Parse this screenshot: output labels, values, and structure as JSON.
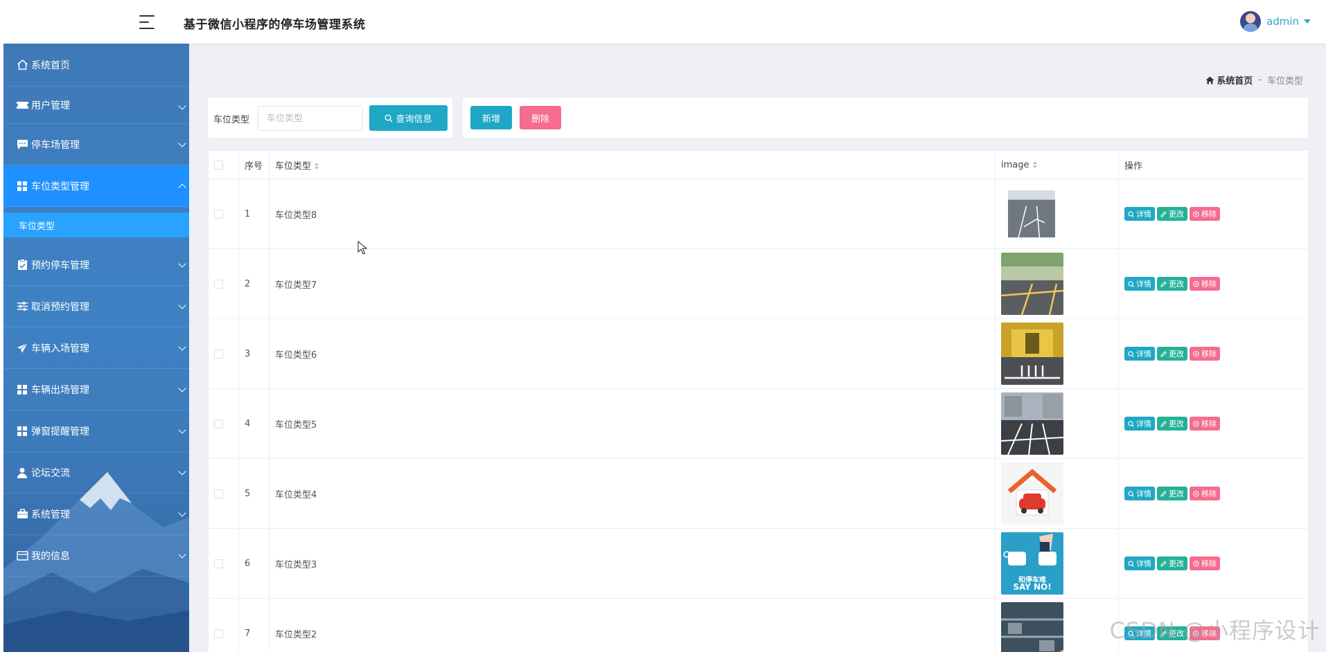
{
  "app": {
    "title": "基于微信小程序的停车场管理系统",
    "user": "admin"
  },
  "sidebar": {
    "items": [
      {
        "label": "系统首页",
        "icon": "home-icon"
      },
      {
        "label": "用户管理",
        "icon": "ticket-icon"
      },
      {
        "label": "停车场管理",
        "icon": "chat-icon"
      },
      {
        "label": "车位类型管理",
        "icon": "grid-icon"
      },
      {
        "label": "预约停车管理",
        "icon": "clipboard-icon"
      },
      {
        "label": "取消预约管理",
        "icon": "sliders-icon"
      },
      {
        "label": "车辆入场管理",
        "icon": "send-icon"
      },
      {
        "label": "车辆出场管理",
        "icon": "grid-icon"
      },
      {
        "label": "弹窗提醒管理",
        "icon": "grid-icon"
      },
      {
        "label": "论坛交流",
        "icon": "user-icon"
      },
      {
        "label": "系统管理",
        "icon": "briefcase-icon"
      },
      {
        "label": "我的信息",
        "icon": "card-icon"
      }
    ],
    "active_sub": "车位类型"
  },
  "breadcrumb": {
    "home": "系统首页",
    "sep": "-",
    "current": "车位类型"
  },
  "search": {
    "label": "车位类型",
    "placeholder": "车位类型",
    "button": "查询信息"
  },
  "actions": {
    "add": "新增",
    "delete": "删除"
  },
  "table": {
    "headers": {
      "index": "序号",
      "type": "车位类型",
      "image": "image",
      "ops": "操作"
    },
    "rows": [
      {
        "index": "1",
        "type": "车位类型8"
      },
      {
        "index": "2",
        "type": "车位类型7"
      },
      {
        "index": "3",
        "type": "车位类型6"
      },
      {
        "index": "4",
        "type": "车位类型5"
      },
      {
        "index": "5",
        "type": "车位类型4"
      },
      {
        "index": "6",
        "type": "车位类型3"
      },
      {
        "index": "7",
        "type": "车位类型2"
      }
    ],
    "ops": {
      "detail": "详情",
      "edit": "更改",
      "remove": "移除"
    },
    "image6_text": [
      "和停车难",
      "SAY NO!"
    ]
  },
  "watermark": "CSDN @小程序设计",
  "colors": {
    "primary": "#1ea8c5",
    "edit": "#25b197",
    "danger": "#f56c8e",
    "sidebar_active": "#1e90ff"
  }
}
